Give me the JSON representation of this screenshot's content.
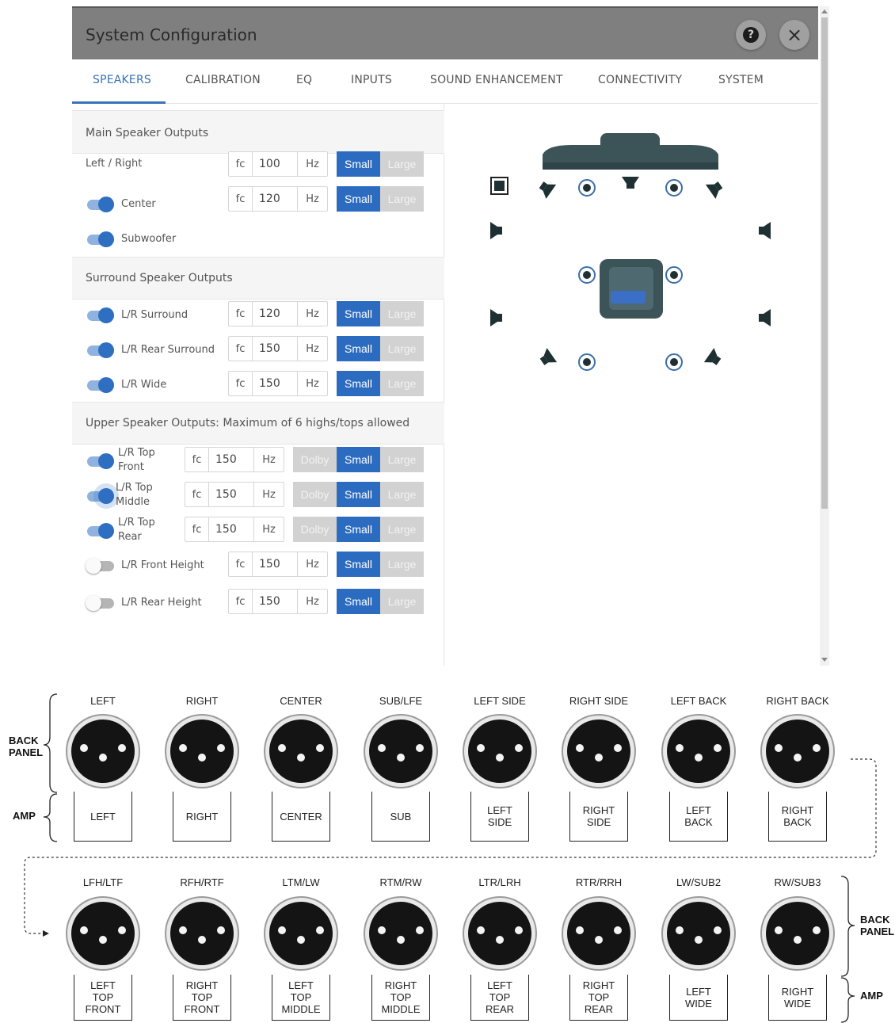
{
  "dialog": {
    "title": "System Configuration",
    "help_glyph": "?",
    "close_glyph": "×",
    "tabs": [
      {
        "label": "SPEAKERS",
        "active": true
      },
      {
        "label": "CALIBRATION",
        "active": false
      },
      {
        "label": "EQ",
        "active": false
      },
      {
        "label": "INPUTS",
        "active": false
      },
      {
        "label": "SOUND ENHANCEMENT",
        "active": false
      },
      {
        "label": "CONNECTIVITY",
        "active": false
      },
      {
        "label": "SYSTEM",
        "active": false
      }
    ],
    "fc_label": "fc",
    "hz_label": "Hz",
    "size_options": {
      "dolby": "Dolby",
      "small": "Small",
      "large": "Large"
    },
    "sections": {
      "main": "Main Speaker Outputs",
      "surround": "Surround Speaker Outputs",
      "upper": "Upper Speaker Outputs: Maximum of 6 highs/tops allowed"
    },
    "rows": {
      "left_right": {
        "label": "Left / Right",
        "fc": "100",
        "size": "Small"
      },
      "center": {
        "label": "Center",
        "enabled": true,
        "fc": "120",
        "size": "Small"
      },
      "subwoofer": {
        "label": "Subwoofer",
        "enabled": true
      },
      "lr_surround": {
        "label": "L/R Surround",
        "enabled": true,
        "fc": "120",
        "size": "Small"
      },
      "lr_rear_surround": {
        "label": "L/R Rear Surround",
        "enabled": true,
        "fc": "150",
        "size": "Small"
      },
      "lr_wide": {
        "label": "L/R Wide",
        "enabled": true,
        "fc": "150",
        "size": "Small"
      },
      "lr_top_front": {
        "label": "L/R Top\nFront",
        "enabled": true,
        "fc": "150",
        "size": "Small"
      },
      "lr_top_middle": {
        "label": "L/R Top\nMiddle",
        "enabled": true,
        "fc": "150",
        "size": "Small"
      },
      "lr_top_rear": {
        "label": "L/R Top\nRear",
        "enabled": true,
        "fc": "150",
        "size": "Small"
      },
      "lr_front_height": {
        "label": "L/R Front Height",
        "enabled": false,
        "fc": "150",
        "size": "Small"
      },
      "lr_rear_height": {
        "label": "L/R Rear Height",
        "enabled": false,
        "fc": "150",
        "size": "Small"
      }
    },
    "accent_color": "#2c6cc0"
  },
  "wiring": {
    "back_panel_label": "BACK\nPANEL",
    "amp_label": "AMP",
    "row1": [
      {
        "panel": "LEFT",
        "amp": "LEFT"
      },
      {
        "panel": "RIGHT",
        "amp": "RIGHT"
      },
      {
        "panel": "CENTER",
        "amp": "CENTER"
      },
      {
        "panel": "SUB/LFE",
        "amp": "SUB"
      },
      {
        "panel": "LEFT SIDE",
        "amp": "LEFT\nSIDE"
      },
      {
        "panel": "RIGHT SIDE",
        "amp": "RIGHT\nSIDE"
      },
      {
        "panel": "LEFT BACK",
        "amp": "LEFT\nBACK"
      },
      {
        "panel": "RIGHT BACK",
        "amp": "RIGHT\nBACK"
      }
    ],
    "row2": [
      {
        "panel": "LFH/LTF",
        "amp": "LEFT\nTOP\nFRONT"
      },
      {
        "panel": "RFH/RTF",
        "amp": "RIGHT\nTOP\nFRONT"
      },
      {
        "panel": "LTM/LW",
        "amp": "LEFT\nTOP\nMIDDLE"
      },
      {
        "panel": "RTM/RW",
        "amp": "RIGHT\nTOP\nMIDDLE"
      },
      {
        "panel": "LTR/LRH",
        "amp": "LEFT\nTOP\nREAR"
      },
      {
        "panel": "RTR/RRH",
        "amp": "RIGHT\nTOP\nREAR"
      },
      {
        "panel": "LW/SUB2",
        "amp": "LEFT\nWIDE"
      },
      {
        "panel": "RW/SUB3",
        "amp": "RIGHT\nWIDE"
      }
    ]
  }
}
